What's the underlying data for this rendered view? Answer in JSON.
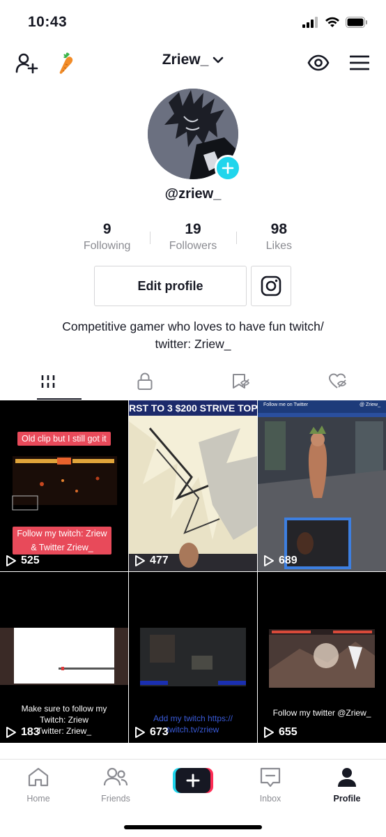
{
  "status": {
    "time": "10:43"
  },
  "header": {
    "username": "Zriew_"
  },
  "profile": {
    "handle": "@zriew_",
    "following_count": "9",
    "following_label": "Following",
    "followers_count": "19",
    "followers_label": "Followers",
    "likes_count": "98",
    "likes_label": "Likes",
    "edit_profile_label": "Edit profile",
    "bio_line1": "Competitive gamer who loves to have fun twitch/",
    "bio_line2": "twitter: Zriew_"
  },
  "videos": [
    {
      "views": "525",
      "caption_top": "Old clip but I still got it",
      "caption_bottom_1": "Follow my twitch: Zriew",
      "caption_bottom_2": "& Twitter Zriew_"
    },
    {
      "views": "477",
      "caption_top": "RST TO 3 $200 STRIVE TOP"
    },
    {
      "views": "689",
      "caption_top": "Follow me on Twitter",
      "caption_top_right": "@ Zriew_"
    },
    {
      "views": "183",
      "caption_1": "Make sure to follow my",
      "caption_2": "Twitch: Zriew",
      "caption_3": "Twitter: Zriew_"
    },
    {
      "views": "673",
      "caption_1": "Add  my twitch https://",
      "caption_2": "twitch.tv/zriew"
    },
    {
      "views": "655",
      "caption_1": "Follow my twitter @Zriew_"
    }
  ],
  "tabbar": {
    "home": "Home",
    "friends": "Friends",
    "inbox": "Inbox",
    "profile": "Profile"
  },
  "colors": {
    "accent_cyan": "#20d5ec",
    "accent_red": "#fe2c55",
    "caption_red": "#e84a5a"
  }
}
